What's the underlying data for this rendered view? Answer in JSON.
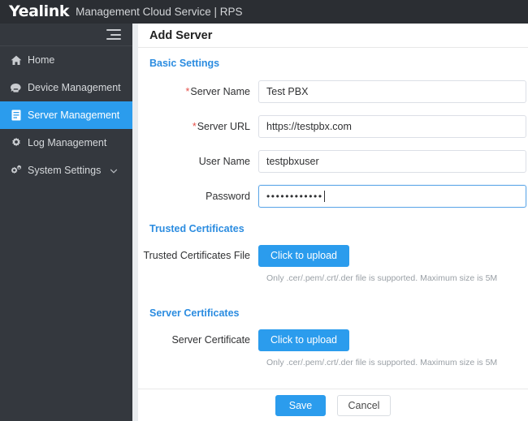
{
  "header": {
    "logo": "Yealink",
    "subtitle": "Management Cloud Service | RPS",
    "background": "#2b2e33"
  },
  "sidebar": {
    "toggle_icon": "hamburger-menu-icon",
    "active_color": "#2b9ced",
    "items": [
      {
        "label": "Home",
        "icon": "home-icon",
        "active": false,
        "expandable": false
      },
      {
        "label": "Device Management",
        "icon": "telephone-icon",
        "active": false,
        "expandable": false
      },
      {
        "label": "Server Management",
        "icon": "server-document-icon",
        "active": true,
        "expandable": false
      },
      {
        "label": "Log Management",
        "icon": "gear-icon",
        "active": false,
        "expandable": false
      },
      {
        "label": "System Settings",
        "icon": "cogs-icon",
        "active": false,
        "expandable": true
      }
    ]
  },
  "main": {
    "title": "Add Server",
    "sections": {
      "basic": {
        "heading": "Basic Settings",
        "fields": [
          {
            "label": "Server Name",
            "required": true,
            "value": "Test PBX",
            "placeholder": "",
            "focused": false,
            "type": "text"
          },
          {
            "label": "Server URL",
            "required": true,
            "value": "https://testpbx.com",
            "placeholder": "",
            "focused": false,
            "type": "text"
          },
          {
            "label": "User Name",
            "required": false,
            "value": "testpbxuser",
            "placeholder": "",
            "focused": false,
            "type": "text"
          },
          {
            "label": "Password",
            "required": false,
            "value": "••••••••••••",
            "placeholder": "",
            "focused": true,
            "type": "password"
          }
        ]
      },
      "trusted": {
        "heading": "Trusted Certificates",
        "field_label": "Trusted Certificates File",
        "upload_button": "Click to upload",
        "hint": "Only .cer/.pem/.crt/.der file is supported. Maximum size is 5M"
      },
      "server_certs": {
        "heading": "Server Certificates",
        "field_label": "Server Certificate",
        "upload_button": "Click to upload",
        "hint": "Only .cer/.pem/.crt/.der file is supported. Maximum size is 5M"
      }
    },
    "footer": {
      "save_label": "Save",
      "cancel_label": "Cancel"
    }
  }
}
